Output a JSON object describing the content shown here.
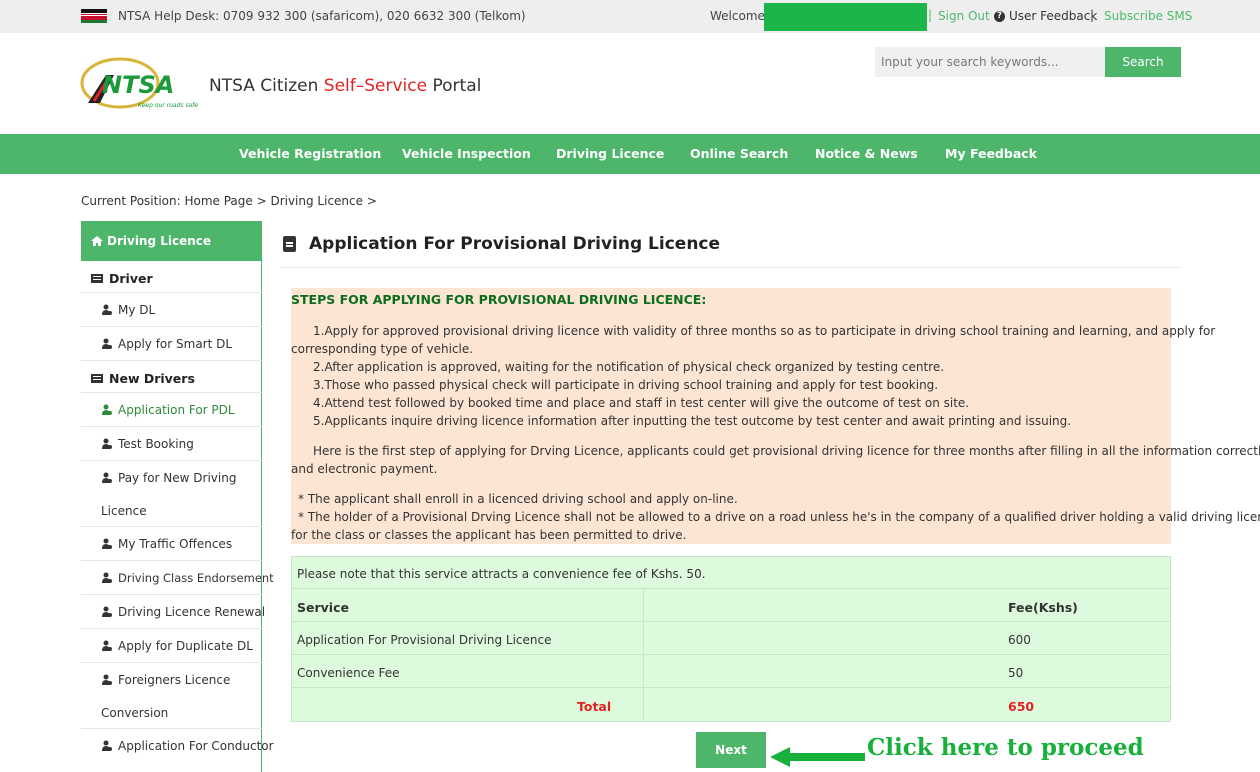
{
  "topbar": {
    "helpdesk": "NTSA Help Desk: 0709 932 300 (safaricom), 020 6632 300 (Telkom)",
    "welcome": "Welcome",
    "sep": "|",
    "sign_out": "Sign Out",
    "user_feedback": "User Feedback",
    "subscribe": "Subscribe SMS",
    "colors": {
      "accent": "#4db66b",
      "welcome_box": "#1db54a"
    }
  },
  "header": {
    "logo_text": "NTSA",
    "logo_tagline": "Keep our roads safe",
    "title_part1": "NTSA Citizen ",
    "title_part2": "Self–Service",
    "title_part3": " Portal",
    "search_placeholder": "Input your search keywords...",
    "search_button": "Search"
  },
  "nav": [
    {
      "label": "Vehicle Registration"
    },
    {
      "label": "Vehicle Inspection"
    },
    {
      "label": "Driving Licence"
    },
    {
      "label": "Online Search"
    },
    {
      "label": "Notice & News"
    },
    {
      "label": "My Feedback"
    }
  ],
  "breadcrumb": "Current Position: Home Page > Driving Licence >",
  "sidebar": {
    "heading": "Driving Licence",
    "cat_driver": "Driver",
    "cat_new_drivers": "New Drivers",
    "items": [
      {
        "label": "My DL"
      },
      {
        "label": "Apply for Smart DL"
      },
      {
        "label": "Application For PDL"
      },
      {
        "label": "Test Booking"
      },
      {
        "label": "Pay for New Driving",
        "label2": "Licence"
      },
      {
        "label": "My Traffic Offences"
      },
      {
        "label": "Driving Class Endorsement"
      },
      {
        "label": "Driving Licence Renewal"
      },
      {
        "label": "Apply for Duplicate DL"
      },
      {
        "label": "Foreigners Licence",
        "label2": "Conversion"
      },
      {
        "label": "Application For Conductor"
      }
    ]
  },
  "main": {
    "title": "Application For Provisional Driving Licence",
    "steps_heading": "STEPS FOR APPLYING FOR PROVISIONAL DRIVING LICENCE:",
    "step1a": "1.Apply for approved provisional driving licence with validity of three months so as to participate in driving school training and learning, and apply for",
    "step1b": "corresponding type of vehicle.",
    "step2": "2.After application is approved, waiting for the notification of physical check organized by testing centre.",
    "step3": "3.Those who passed physical check will participate in driving school training and apply for test booking.",
    "step4": "4.Attend test followed by booked time and place and staff in test center will give the outcome of test on site.",
    "step5": "5.Applicants inquire driving licence information after inputting the test outcome by test center and await printing and issuing.",
    "para_a": "Here is the first step of applying for Drving Licence, applicants could get provisional driving licence for three months after filling in all the information correctly",
    "para_b": "and electronic payment.",
    "note1": "*  The applicant shall enroll in a licenced driving school and apply on-line.",
    "note2a": "*  The holder of a Provisional Drving Licence shall not be allowed to a drive on a road unless he's in the company of a qualified driver holding a valid driving licence",
    "note2b": "for the class or classes the applicant has been permitted to drive."
  },
  "fees": {
    "notice": "Please note that this service attracts a convenience fee of Kshs. 50.",
    "col_service": "Service",
    "col_fee": "Fee(Kshs)",
    "rows": [
      {
        "service": "Application For Provisional Driving Licence",
        "fee": "600"
      },
      {
        "service": "Convenience Fee",
        "fee": "50"
      }
    ],
    "total_label": "Total",
    "total_value": "650"
  },
  "next_button": "Next",
  "annotation": "Click here to proceed"
}
